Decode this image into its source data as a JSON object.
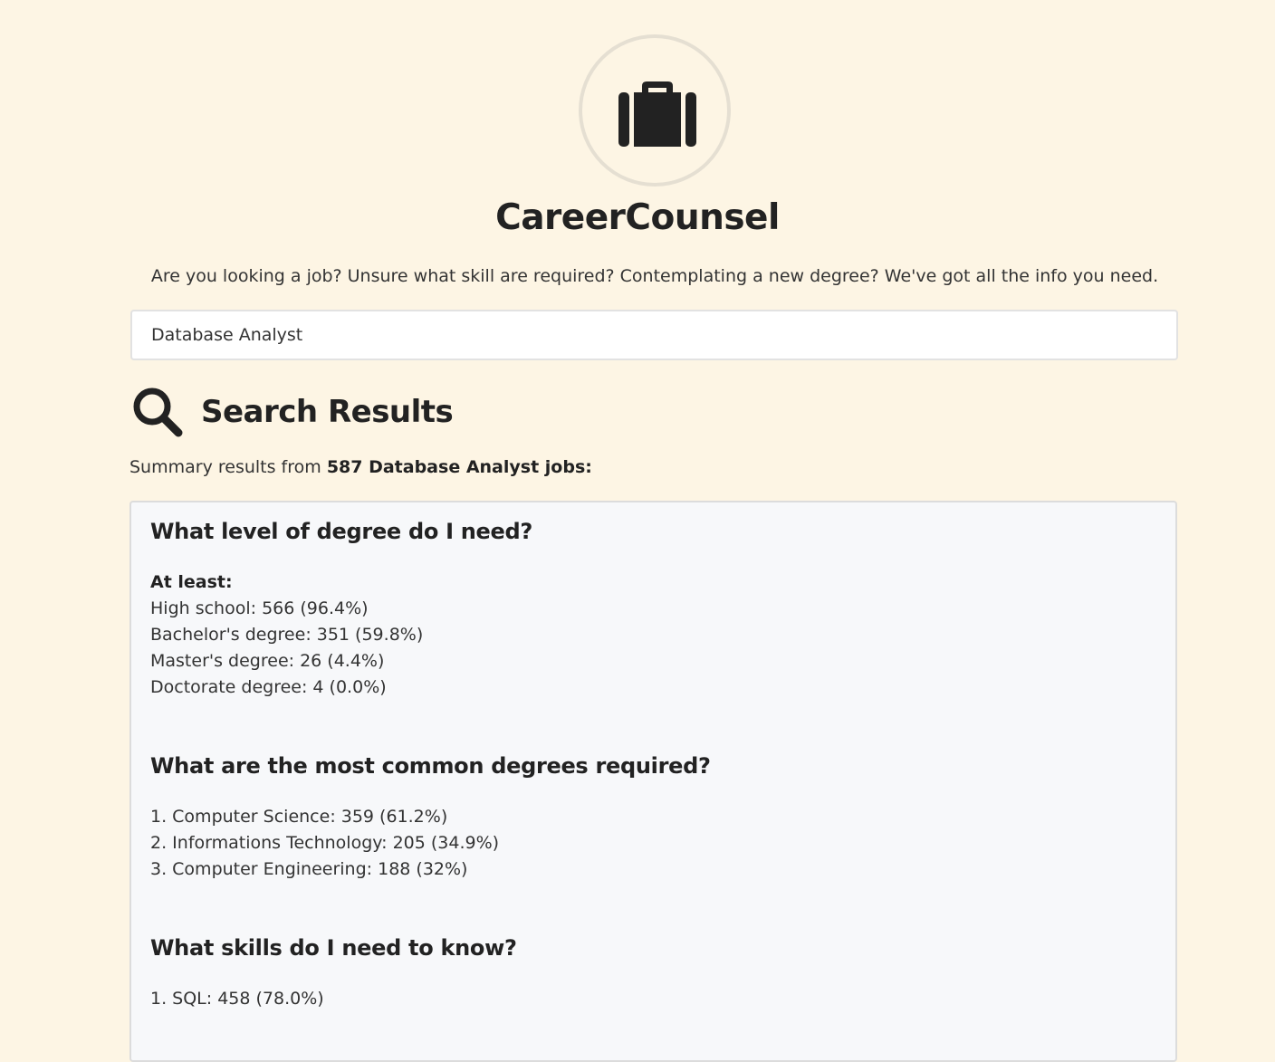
{
  "app": {
    "icon": "briefcase-icon",
    "title": "CareerCounsel",
    "tagline": "Are you looking a job? Unsure what skill are required? Contemplating a new degree? We've got all the info you need."
  },
  "search": {
    "value": "Database Analyst"
  },
  "results": {
    "icon": "search-icon",
    "title": "Search Results",
    "summary_prefix": "Summary results from ",
    "summary_bold": "587 Database Analyst jobs:"
  },
  "degree_level": {
    "heading": "What level of degree do I need?",
    "subheading": "At least:",
    "items": [
      "High school: 566 (96.4%)",
      "Bachelor's degree: 351 (59.8%)",
      "Master's degree: 26 (4.4%)",
      "Doctorate degree: 4 (0.0%)"
    ]
  },
  "common_degrees": {
    "heading": "What are the most common degrees required?",
    "items": [
      "1. Computer Science: 359 (61.2%)",
      "2. Informations Technology: 205 (34.9%)",
      "3. Computer Engineering: 188 (32%)"
    ]
  },
  "skills": {
    "heading": "What skills do I need to know?",
    "items": [
      "1. SQL: 458 (78.0%)"
    ]
  },
  "colors": {
    "background": "#fdf5e4",
    "panel": "#f7f8fa",
    "text": "#222222"
  }
}
